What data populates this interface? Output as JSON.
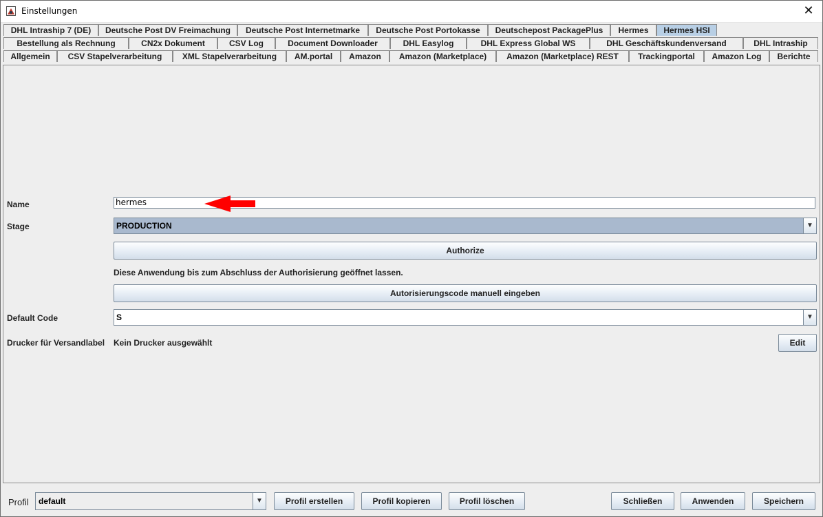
{
  "window": {
    "title": "Einstellungen",
    "close_glyph": "✕"
  },
  "tabs": {
    "row1": [
      {
        "label": "DHL Intraship 7 (DE)"
      },
      {
        "label": "Deutsche Post DV Freimachung"
      },
      {
        "label": "Deutsche Post Internetmarke"
      },
      {
        "label": "Deutsche Post Portokasse"
      },
      {
        "label": "Deutschepost PackagePlus"
      },
      {
        "label": "Hermes"
      },
      {
        "label": "Hermes HSI",
        "active": true
      }
    ],
    "row2": [
      {
        "label": "Bestellung als Rechnung"
      },
      {
        "label": "CN2x Dokument"
      },
      {
        "label": "CSV Log"
      },
      {
        "label": "Document Downloader"
      },
      {
        "label": "DHL Easylog"
      },
      {
        "label": "DHL Express Global WS"
      },
      {
        "label": "DHL Geschäftskundenversand"
      },
      {
        "label": "DHL Intraship"
      }
    ],
    "row3": [
      {
        "label": "Allgemein"
      },
      {
        "label": "CSV Stapelverarbeitung"
      },
      {
        "label": "XML Stapelverarbeitung"
      },
      {
        "label": "AM.portal"
      },
      {
        "label": "Amazon"
      },
      {
        "label": "Amazon (Marketplace)"
      },
      {
        "label": "Amazon (Marketplace) REST"
      },
      {
        "label": "Trackingportal"
      },
      {
        "label": "Amazon Log"
      },
      {
        "label": "Berichte"
      }
    ]
  },
  "form": {
    "name_label": "Name",
    "name_value": "hermes",
    "stage_label": "Stage",
    "stage_value": "PRODUCTION",
    "authorize_button": "Authorize",
    "info_text": "Diese Anwendung bis zum Abschluss der Authorisierung geöffnet lassen.",
    "manual_code_button": "Autorisierungscode manuell eingeben",
    "default_code_label": "Default Code",
    "default_code_value": "S",
    "printer_label": "Drucker für Versandlabel",
    "printer_value": "Kein Drucker ausgewählt",
    "edit_button": "Edit"
  },
  "footer": {
    "profile_label": "Profil",
    "profile_value": "default",
    "create_profile": "Profil erstellen",
    "copy_profile": "Profil kopieren",
    "delete_profile": "Profil löschen",
    "close": "Schließen",
    "apply": "Anwenden",
    "save": "Speichern"
  },
  "colors": {
    "active_tab": "#b8cfe5",
    "selected_combo": "#a9b9ce",
    "annotation_arrow": "#ff0000"
  }
}
